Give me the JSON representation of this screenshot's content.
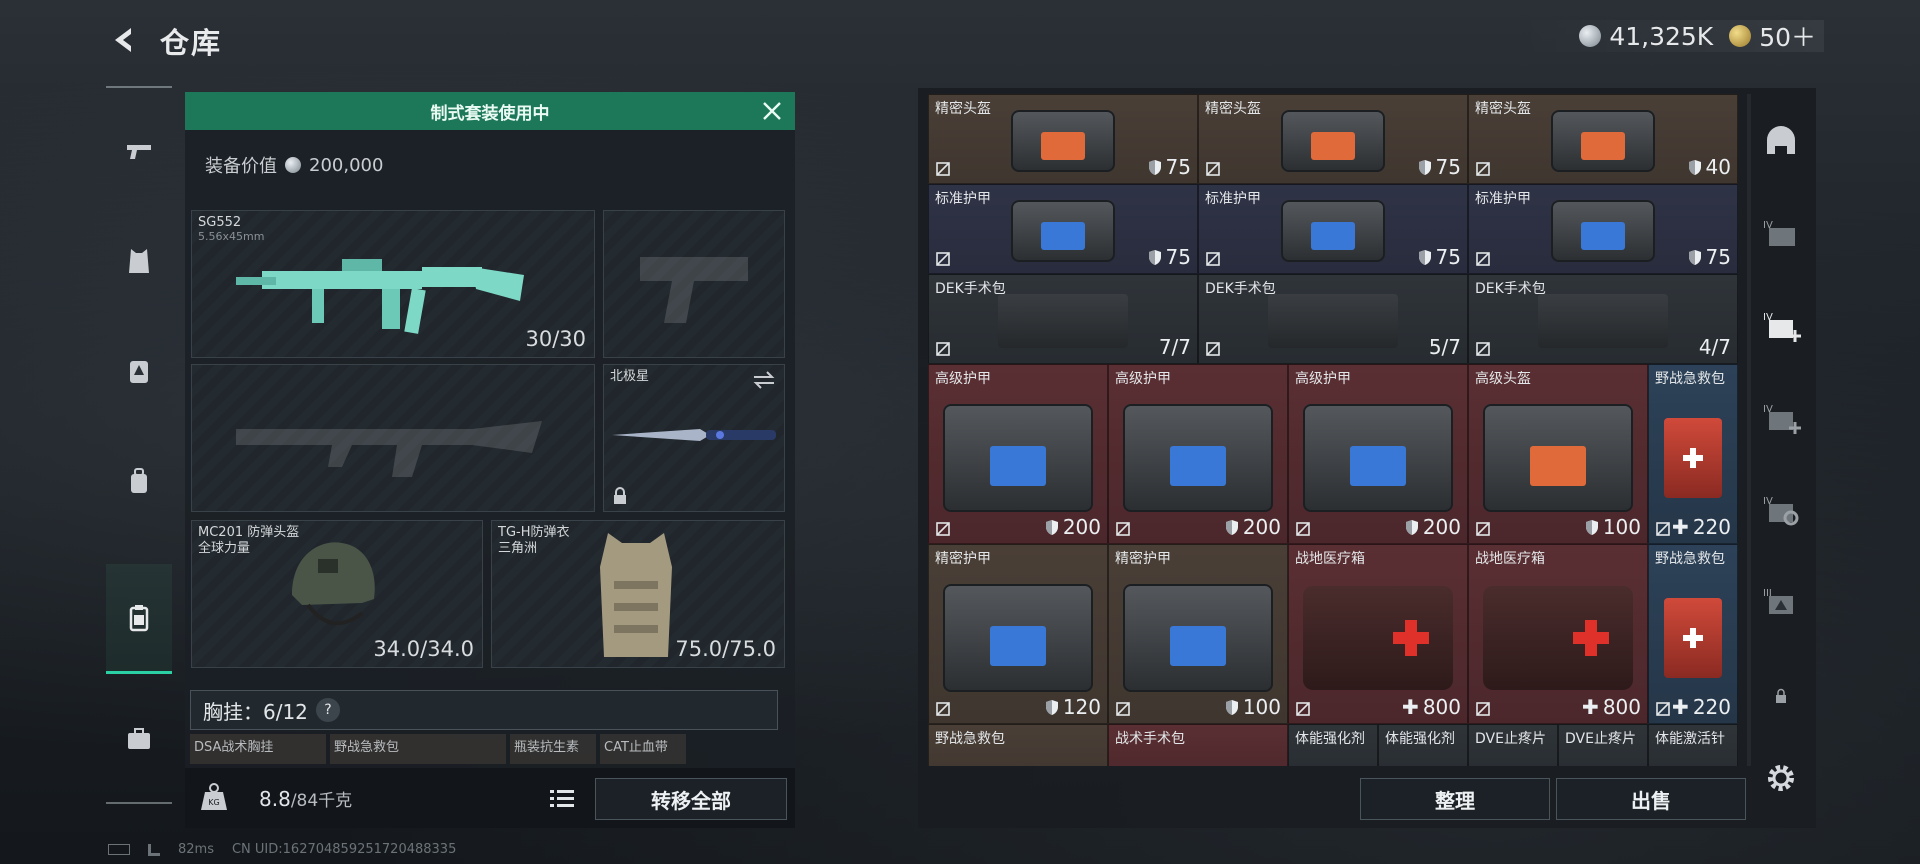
{
  "header": {
    "title": "仓库"
  },
  "currency": {
    "coins": "41,325K",
    "gold": "50＋"
  },
  "equipment": {
    "banner": "制式套装使用中",
    "value_label": "装备价值",
    "value": "200,000",
    "primary_weapon": {
      "name": "SG552",
      "caliber": "5.56x45mm",
      "ammo": "30/30"
    },
    "melee": {
      "name": "北极星"
    },
    "helmet": {
      "name": "MC201 防弹头盔",
      "owner": "全球力量",
      "durability": "34.0/34.0"
    },
    "armor": {
      "name": "TG-H防弹衣",
      "owner": "三角洲",
      "durability": "75.0/75.0"
    },
    "chest_rig": {
      "label": "胸挂：6/12",
      "help": "?"
    },
    "rig_items": [
      "DSA战术胸挂",
      "野战急救包",
      "瓶装抗生素",
      "CAT止血带"
    ],
    "weight": "8.8",
    "weight_max": "/84千克",
    "transfer_all": "转移全部"
  },
  "warehouse": {
    "items": [
      {
        "name": "精密头盔",
        "value": "75",
        "icon": "shield"
      },
      {
        "name": "精密头盔",
        "value": "75",
        "icon": "shield"
      },
      {
        "name": "精密头盔",
        "value": "40",
        "icon": "shield"
      },
      {
        "name": "标准护甲",
        "value": "75",
        "icon": "shield"
      },
      {
        "name": "标准护甲",
        "value": "75",
        "icon": "shield"
      },
      {
        "name": "标准护甲",
        "value": "75",
        "icon": "shield"
      },
      {
        "name": "DEK手术包",
        "value": "7/7",
        "icon": "none"
      },
      {
        "name": "DEK手术包",
        "value": "5/7",
        "icon": "none"
      },
      {
        "name": "DEK手术包",
        "value": "4/7",
        "icon": "none"
      },
      {
        "name": "高级护甲",
        "value": "200",
        "icon": "shield"
      },
      {
        "name": "高级护甲",
        "value": "200",
        "icon": "shield"
      },
      {
        "name": "高级护甲",
        "value": "200",
        "icon": "shield"
      },
      {
        "name": "高级头盔",
        "value": "100",
        "icon": "shield"
      },
      {
        "name": "野战急救包",
        "value": "220",
        "icon": "plus"
      },
      {
        "name": "精密护甲",
        "value": "120",
        "icon": "shield"
      },
      {
        "name": "精密护甲",
        "value": "100",
        "icon": "shield"
      },
      {
        "name": "战地医疗箱",
        "value": "800",
        "icon": "plus"
      },
      {
        "name": "战地医疗箱",
        "value": "800",
        "icon": "plus"
      },
      {
        "name": "野战急救包",
        "value": "220",
        "icon": "plus"
      },
      {
        "name": "野战急救包",
        "value": "",
        "icon": "none"
      },
      {
        "name": "战术手术包",
        "value": "",
        "icon": "none"
      },
      {
        "name": "体能强化剂",
        "value": "",
        "icon": "none"
      },
      {
        "name": "体能强化剂",
        "value": "",
        "icon": "none"
      },
      {
        "name": "DVE止疼片",
        "value": "",
        "icon": "none"
      },
      {
        "name": "DVE止疼片",
        "value": "",
        "icon": "none"
      },
      {
        "name": "体能激活针",
        "value": "",
        "icon": "none"
      }
    ],
    "sort_label": "整理",
    "sell_label": "出售"
  },
  "status": {
    "ping": "82ms",
    "uid": "CN UID:1627048592517204883​35"
  },
  "colors": {
    "accent": "#1d7759",
    "active_tab": "#2bd0a4"
  }
}
